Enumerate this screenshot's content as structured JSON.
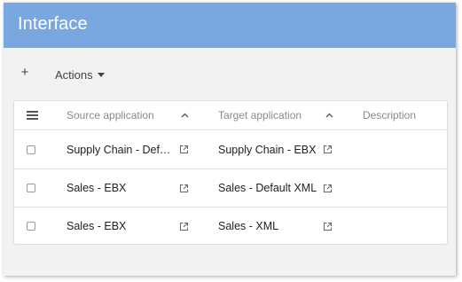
{
  "header": {
    "title": "Interface"
  },
  "toolbar": {
    "add_label": "+",
    "actions_label": "Actions"
  },
  "table": {
    "columns": {
      "source": "Source application",
      "target": "Target application",
      "description": "Description"
    },
    "rows": [
      {
        "source": "Supply Chain - Default XML",
        "target": "Supply Chain - EBX",
        "description": ""
      },
      {
        "source": "Sales - EBX",
        "target": "Sales - Default XML",
        "description": ""
      },
      {
        "source": "Sales - EBX",
        "target": "Sales - XML",
        "description": ""
      }
    ]
  },
  "icons": {
    "menu": "hamburger-menu-icon",
    "sort": "chevron-up-icon",
    "external": "external-link-icon",
    "dropdown": "caret-down-icon"
  },
  "colors": {
    "header_bg": "#7aa7df",
    "page_bg": "#f2f2f2"
  }
}
